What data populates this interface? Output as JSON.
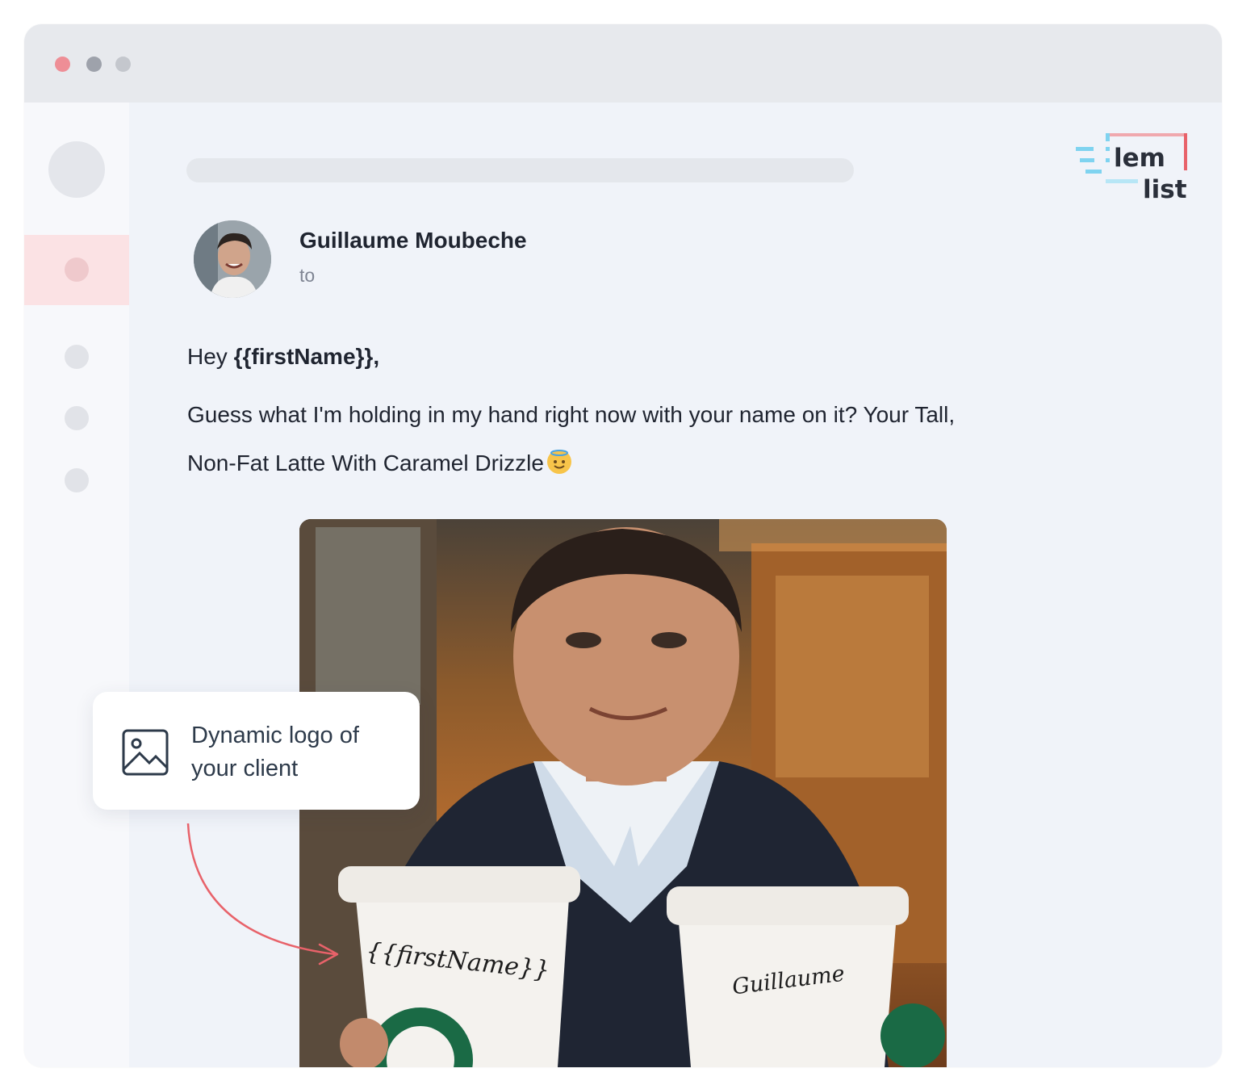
{
  "window": {
    "traffic_lights": [
      "#ee8e96",
      "#9ea2ab",
      "#c4c7cd"
    ]
  },
  "logo": {
    "line1": "lem",
    "line2": "list"
  },
  "email": {
    "sender_name": "Guillaume Moubeche",
    "to_label": "to",
    "greeting_prefix": "Hey ",
    "greeting_variable": "{{firstName}},",
    "line1": "Guess what I'm holding in my hand right now with your name on it? Your Tall,",
    "line2": "Non-Fat Latte With Caramel Drizzle",
    "emoji": "smiling-face-with-halo"
  },
  "image": {
    "cup_left_label": "{{firstName}}",
    "cup_right_label": "Guillaume"
  },
  "callout": {
    "icon": "image-icon",
    "text": "Dynamic logo of your client"
  },
  "colors": {
    "accent_red": "#e8626a",
    "active_row": "#fbe2e4",
    "logo_blue": "#7fd3f0"
  }
}
